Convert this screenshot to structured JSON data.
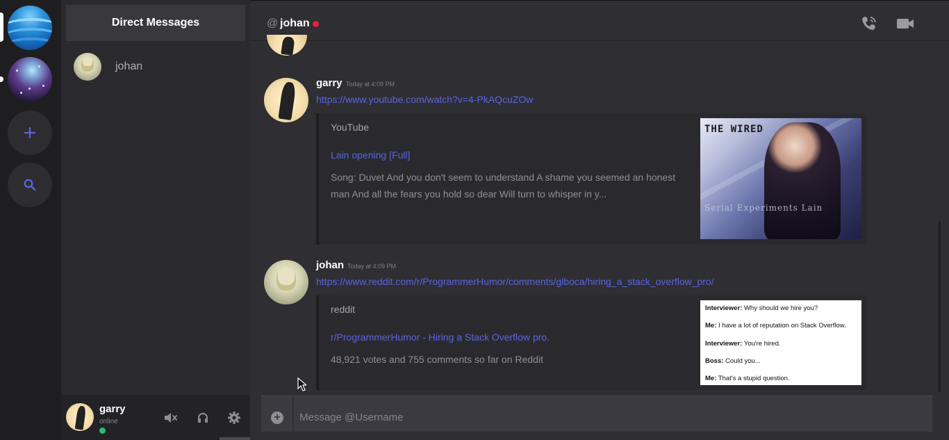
{
  "servers": [
    {
      "name": "server-waves-icon"
    },
    {
      "name": "server-nebula-icon"
    }
  ],
  "server_actions": {
    "add_icon": "plus-icon",
    "search_icon": "search-icon"
  },
  "sidebar": {
    "header": "Direct Messages",
    "items": [
      {
        "label": "johan"
      }
    ]
  },
  "user_panel": {
    "username": "garry",
    "status": "online"
  },
  "channel": {
    "at_symbol": "@",
    "title": "johan"
  },
  "messages": [
    {
      "author": "garry",
      "time": "Today at 4:09 PM",
      "link": "https://www.youtube.com/watch?v=4-PkAQcuZOw",
      "embed": {
        "provider": "YouTube",
        "title": "Lain opening [Full]",
        "description": "Song: Duvet And you don't seem to understand A shame you seemed an honest man And all the fears you hold so dear Will turn to whisper in y...",
        "thumb_top_text": "THE WIRED",
        "thumb_bottom_text": "Serial Experiments Lain"
      }
    },
    {
      "author": "johan",
      "time": "Today at 4:09 PM",
      "link": "https://www.reddit.com/r/ProgrammerHumor/comments/glboca/hiring_a_stack_overflow_pro/",
      "embed": {
        "provider": "reddit",
        "title": "r/ProgrammerHumor - Hiring a Stack Overflow pro.",
        "description": "48,921 votes and 755 comments so far on Reddit",
        "thumb_lines": [
          {
            "speaker": "Interviewer:",
            "text": " Why should we hire you?"
          },
          {
            "speaker": "Me:",
            "text": " I have a lot of reputation on Stack Overflow."
          },
          {
            "speaker": "Interviewer:",
            "text": " You're hired."
          },
          {
            "speaker": "Boss:",
            "text": " Could you..."
          },
          {
            "speaker": "Me:",
            "text": " That's a stupid question."
          }
        ]
      }
    }
  ],
  "composer": {
    "placeholder": "Message @Username"
  },
  "colors": {
    "accent": "#5a64e0",
    "online": "#2dbd6e",
    "recording": "#e8203a"
  }
}
